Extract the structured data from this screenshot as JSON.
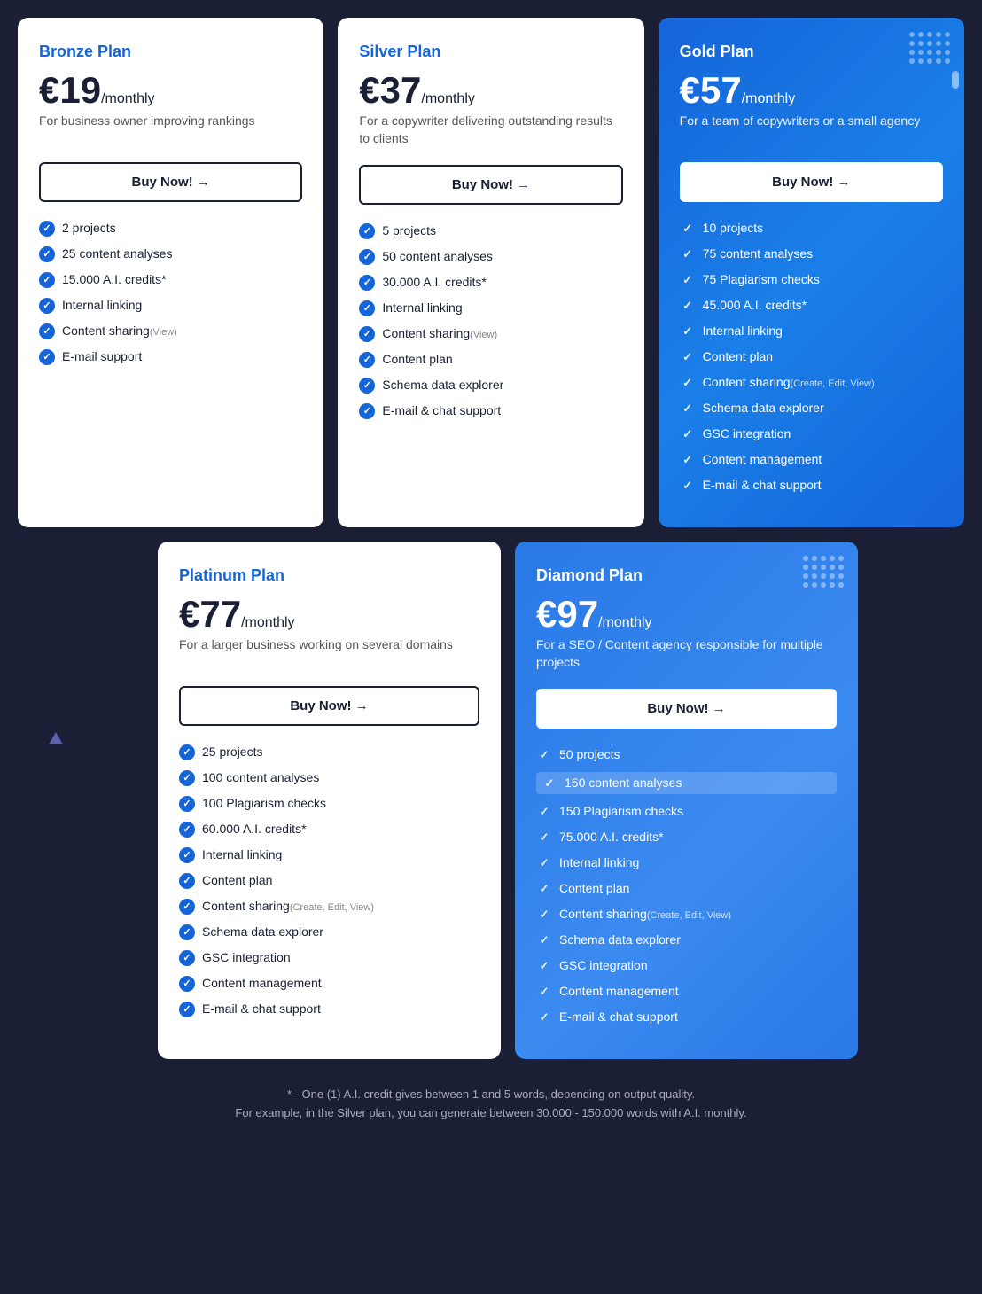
{
  "plans": {
    "bronze": {
      "name": "Bronze Plan",
      "price": "€19",
      "period": "/monthly",
      "description": "For business owner improving rankings",
      "buy_label": "Buy Now!  →",
      "features": [
        {
          "text": "2 projects"
        },
        {
          "text": "25 content analyses"
        },
        {
          "text": "15.000 A.I. credits*"
        },
        {
          "text": "Internal linking"
        },
        {
          "text": "Content sharing",
          "sub": "(View)"
        },
        {
          "text": "E-mail support"
        }
      ]
    },
    "silver": {
      "name": "Silver Plan",
      "price": "€37",
      "period": "/monthly",
      "description": "For a copywriter delivering outstanding results to clients",
      "buy_label": "Buy Now!  →",
      "features": [
        {
          "text": "5 projects"
        },
        {
          "text": "50 content analyses"
        },
        {
          "text": "30.000 A.I. credits*"
        },
        {
          "text": "Internal linking"
        },
        {
          "text": "Content sharing",
          "sub": "(View)"
        },
        {
          "text": "Content plan"
        },
        {
          "text": "Schema data explorer"
        },
        {
          "text": "E-mail & chat support"
        }
      ]
    },
    "gold": {
      "name": "Gold Plan",
      "price": "€57",
      "period": "/monthly",
      "description": "For a team of copywriters or a small agency",
      "buy_label": "Buy Now!  →",
      "features": [
        {
          "text": "10 projects"
        },
        {
          "text": "75 content analyses"
        },
        {
          "text": "75 Plagiarism checks"
        },
        {
          "text": "45.000 A.I. credits*"
        },
        {
          "text": "Internal linking"
        },
        {
          "text": "Content plan"
        },
        {
          "text": "Content sharing",
          "sub": "(Create, Edit, View)"
        },
        {
          "text": "Schema data explorer"
        },
        {
          "text": "GSC integration"
        },
        {
          "text": "Content management"
        },
        {
          "text": "E-mail & chat support"
        }
      ]
    },
    "platinum": {
      "name": "Platinum Plan",
      "price": "€77",
      "period": "/monthly",
      "description": "For a larger business working on several domains",
      "buy_label": "Buy Now!  →",
      "features": [
        {
          "text": "25 projects"
        },
        {
          "text": "100 content analyses"
        },
        {
          "text": "100 Plagiarism checks"
        },
        {
          "text": "60.000 A.I. credits*"
        },
        {
          "text": "Internal linking"
        },
        {
          "text": "Content plan"
        },
        {
          "text": "Content sharing",
          "sub": "(Create, Edit, View)"
        },
        {
          "text": "Schema data explorer"
        },
        {
          "text": "GSC integration"
        },
        {
          "text": "Content management"
        },
        {
          "text": "E-mail & chat support"
        }
      ]
    },
    "diamond": {
      "name": "Diamond Plan",
      "price": "€97",
      "period": "/monthly",
      "description": "For a SEO / Content agency responsible for multiple projects",
      "buy_label": "Buy Now!  →",
      "features": [
        {
          "text": "50 projects",
          "highlight": false
        },
        {
          "text": "150 content analyses",
          "highlight": true
        },
        {
          "text": "150 Plagiarism checks"
        },
        {
          "text": "75.000 A.I. credits*"
        },
        {
          "text": "Internal linking"
        },
        {
          "text": "Content plan"
        },
        {
          "text": "Content sharing",
          "sub": "(Create, Edit, View)"
        },
        {
          "text": "Schema data explorer"
        },
        {
          "text": "GSC integration"
        },
        {
          "text": "Content management"
        },
        {
          "text": "E-mail & chat support"
        }
      ]
    }
  },
  "footer": {
    "note1": "* - One (1) A.I. credit gives between 1 and 5 words, depending on output quality.",
    "note2": "For example, in the Silver plan, you can generate between 30.000 - 150.000 words with A.I. monthly."
  }
}
